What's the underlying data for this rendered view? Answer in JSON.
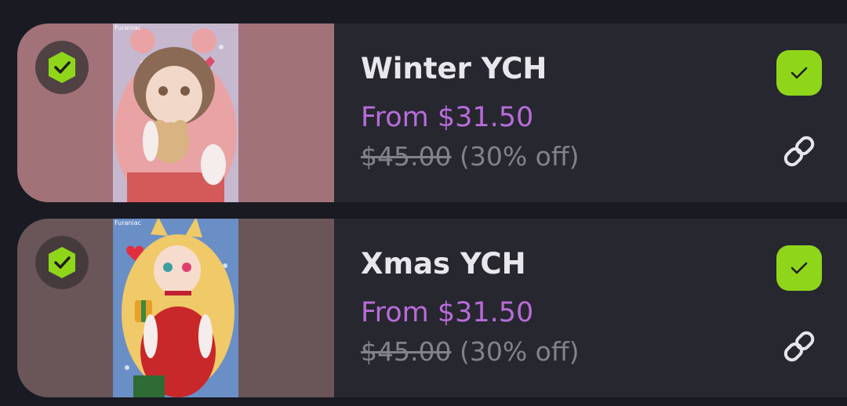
{
  "items": [
    {
      "title": "Winter YCH",
      "price": "From $31.50",
      "original_price": "$45.00",
      "discount": "(30% off)",
      "thumbnail_artist": "Furaniac",
      "selected": true
    },
    {
      "title": "Xmas YCH",
      "price": "From $31.50",
      "original_price": "$45.00",
      "discount": "(30% off)",
      "thumbnail_artist": "Furaniac",
      "selected": true
    }
  ],
  "colors": {
    "background": "#1a1a22",
    "card": "#272730",
    "accent_price": "#b86cd9",
    "accent_check": "#8fd61a",
    "muted_text": "#82828a"
  },
  "icons": {
    "badge": "verified-hexagon-icon",
    "check": "checkmark-icon",
    "link": "link-icon"
  }
}
